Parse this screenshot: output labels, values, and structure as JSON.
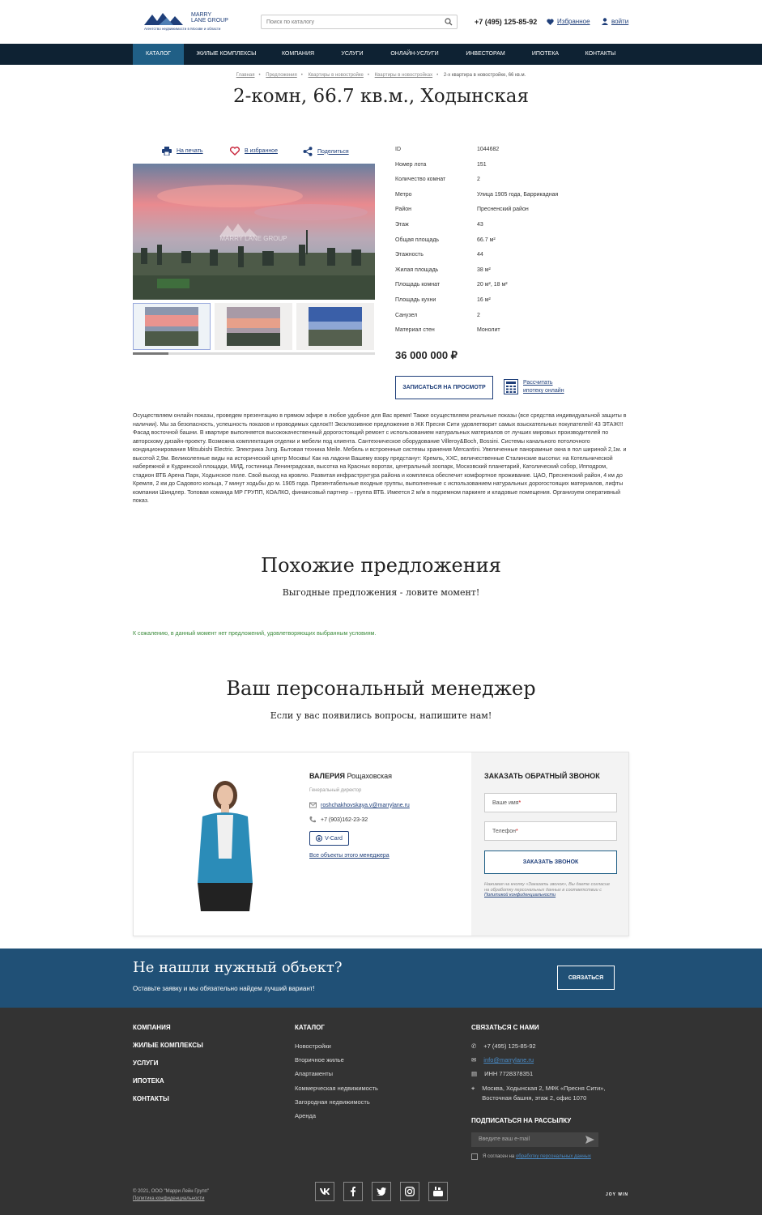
{
  "header": {
    "logo_name": "MARRY LANE GROUP",
    "logo_line1": "MARRY",
    "logo_line2": "LANE GROUP",
    "logo_tagline": "Агентство недвижимости в Москве и области",
    "search_placeholder": "Поиск по каталогу",
    "phone": "+7 (495) 125-85-92",
    "favorites": "Избранное",
    "login": "войти"
  },
  "nav": [
    "Каталог",
    "Жилые комплексы",
    "Компания",
    "Услуги",
    "Онлайн-услуги",
    "Инвесторам",
    "Ипотека",
    "Контакты"
  ],
  "breadcrumb": [
    "Главная",
    "Предложения",
    "Квартиры в новостройке",
    "Квартиры в новостройках",
    "2-х квартира в новостройке, 66 кв.м."
  ],
  "title": "2-комн, 66.7 кв.м., Ходынская",
  "actions": {
    "print": "На печать",
    "favorite": "В избранное",
    "share": "Поделиться"
  },
  "gallery": {
    "watermark": "MARRY LANE GROUP"
  },
  "specs": [
    {
      "k": "ID",
      "v": "1044682"
    },
    {
      "k": "Номер лота",
      "v": "151"
    },
    {
      "k": "Количество комнат",
      "v": "2"
    },
    {
      "k": "Метро",
      "v": "Улица 1905 года, Баррикадная"
    },
    {
      "k": "Район",
      "v": "Пресненский район"
    },
    {
      "k": "Этаж",
      "v": "43"
    },
    {
      "k": "Общая площадь",
      "v": "66.7 м²"
    },
    {
      "k": "Этажность",
      "v": "44"
    },
    {
      "k": "Жилая площадь",
      "v": "38 м²"
    },
    {
      "k": "Площадь комнат",
      "v": "20 м², 18 м²"
    },
    {
      "k": "Площадь кухни",
      "v": "16 м²"
    },
    {
      "k": "Санузел",
      "v": "2"
    },
    {
      "k": "Материал стен",
      "v": "Монолит"
    }
  ],
  "price": "36 000 000 ₽",
  "view_button": "Записаться на просмотр",
  "mortgage": {
    "line1": "Рассчитать",
    "line2": "ипотеку онлайн"
  },
  "description": "Осуществляем онлайн показы, проведем презентацию в прямом эфире в любое удобное для Вас время! Также осуществляем реальные показы (все средства индивидуальной защиты в наличии). Мы за безопасность, успешность показов и проводимых сделок!!! Эксклюзивное предложение в ЖК Пресня Сити удовлетворит самых взыскательных покупателей! 43 ЭТАЖ!!! Фасад восточной башни. В квартире выполняется высококачественный дорогостоящий ремонт с использованием натуральных материалов от лучших мировых производителей по авторскому дизайн-проекту. Возможна комплектация отделки и мебели под клиента. Сантехническое оборудование Villeroy&Boch, Bossini. Системы канального потолочного кондиционирования Mitsubishi Electric. Электрика Jung. Бытовая техника Meile. Мебель и встроенные системы хранения Mercantini. Увеличенные панорамные окна в пол шириной 2,1м. и высотой 2,9м. Великолепные виды на исторический центр Москвы! Как на ладони Вашему взору предстанут: Кремль, ХХС, величественные Сталинские высотки: на Котельнической набережной и Кудринской площади, МИД, гостиница Ленинградская, высотка на Красных воротах, центральный зоопарк, Московский планетарий, Католический собор, Ипподром, стадион ВТБ Арена Парк, Ходынское поле. Свой выход на кровлю. Развитая инфраструктура района и комплекса обеспечит комфортное проживание. ЦАО, Пресненский район, 4 км до Кремля, 2 км до Садового кольца, 7 минут ходьбы до м. 1905 года. Презентабельные входные группы, выполненные с использованием натуральных дорогостоящих материалов, лифты компании Шиндлер. Топовая команда МР ГРУПП, КОАЛКО, финансовый партнер – группа ВТБ. Имеется 2 м/м в подземном паркинге и кладовые помещения. Организуем оперативный показ.",
  "similar": {
    "title": "Похожие предложения",
    "subtitle": "Выгодные предложения - ловите момент!",
    "empty": "К сожалению, в данный момент нет предложений, удовлетворяющих выбранным условиям."
  },
  "manager_section": {
    "title": "Ваш персональный менеджер",
    "subtitle": "Если у вас появились вопросы, напишите нам!"
  },
  "manager": {
    "first": "ВАЛЕРИЯ",
    "last": "Рощаховская",
    "role": "Генеральный директор",
    "email": "roshchakhovskaya.v@marrylane.ru",
    "phone": "+7 (903)162-23-32",
    "vcard": "V-Card",
    "all": "Все объекты этого менеджера"
  },
  "callback": {
    "title": "Заказать обратный звонок",
    "name_ph": "Ваше имя",
    "phone_ph": "Телефон",
    "button": "Заказать звонок",
    "note": "Нажимая на кнопку «Заказать звонок», Вы даете согласие на обработку персональных данных в соответствии с",
    "note_link": "Политикой конфиденциальности"
  },
  "banner": {
    "title": "Не нашли нужный объект?",
    "subtitle": "Оставьте заявку и мы обязательно найдем лучший вариант!",
    "button": "Связаться"
  },
  "footer": {
    "col1": [
      "Компания",
      "Жилые комплексы",
      "Услуги",
      "Ипотека",
      "Контакты"
    ],
    "col2_title": "Каталог",
    "col2": [
      "Новостройки",
      "Вторичное жилье",
      "Апартаменты",
      "Коммерческая недвижимость",
      "Загородная недвижимость",
      "Аренда"
    ],
    "contacts_title": "Связаться с нами",
    "phone": "+7 (495) 125-85-92",
    "email": "info@marrylane.ru",
    "inn": "ИНН 7728378351",
    "address": "Москва, Ходынская 2, МФК «Пресня Сити», Восточная башня, этаж 2, офис 1070",
    "subscribe_title": "Подписаться на рассылку",
    "email_placeholder": "Введите ваш e-mail",
    "agree_text": "Я согласен на",
    "agree_link": "обработку персональных данных",
    "copyright": "© 2021, ООО \"Марри Лейн Групп\"",
    "privacy": "Политика конфиденциальности",
    "developer": "JOY WIN"
  },
  "colors": {
    "navy": "#0e2233",
    "accent": "#205f86",
    "brand": "#1f3f7a",
    "banner": "#205076",
    "footer": "#333333"
  }
}
